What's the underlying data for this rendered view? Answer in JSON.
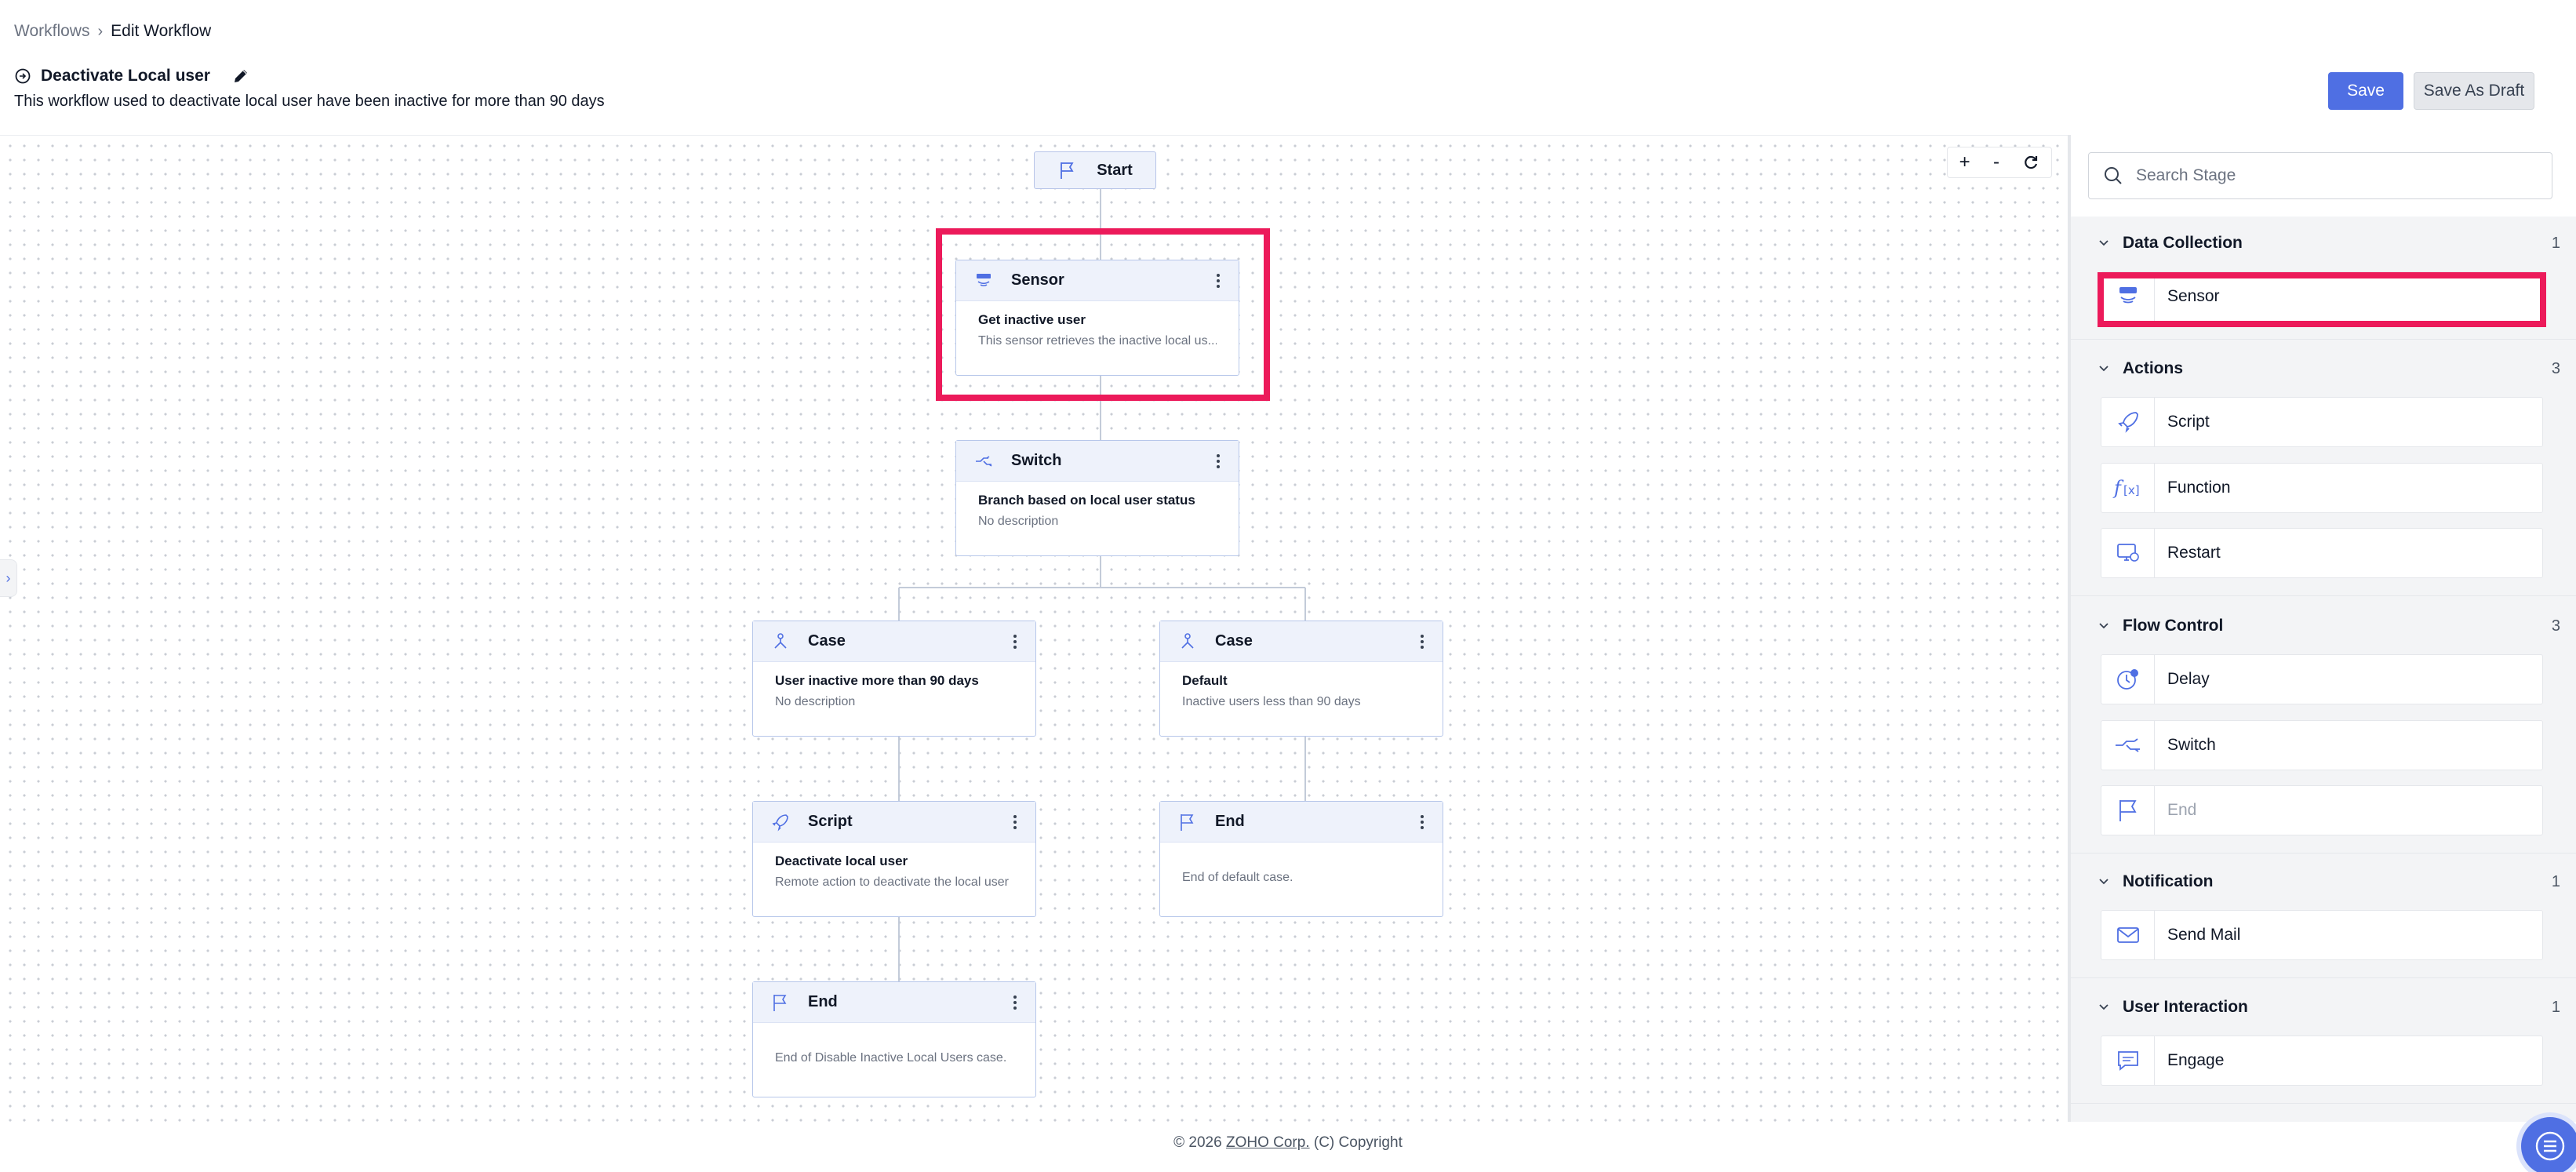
{
  "breadcrumb": {
    "parent": "Workflows",
    "current": "Edit Workflow"
  },
  "workflow": {
    "title": "Deactivate Local user",
    "description": "This workflow used to deactivate local user have been inactive for more than 90 days"
  },
  "actions": {
    "save": "Save",
    "save_draft": "Save As Draft"
  },
  "colors": {
    "accent": "#4f6fe3",
    "highlight": "#ec1a5a",
    "node_header": "#eef2fb",
    "node_border": "#b7c7ea"
  },
  "canvas": {
    "zoom_controls": {
      "zoom_in": "+",
      "zoom_out": "-",
      "reset_icon": "refresh-icon"
    },
    "start": {
      "label": "Start",
      "icon": "flag-icon"
    },
    "nodes": {
      "sensor": {
        "type": "Sensor",
        "icon": "sensor-icon",
        "name": "Get inactive user",
        "desc": "This sensor retrieves the inactive local us..."
      },
      "switch": {
        "type": "Switch",
        "icon": "switch-icon",
        "name": "Branch based on local user status",
        "desc": "No description"
      },
      "case1": {
        "type": "Case",
        "icon": "case-icon",
        "name": "User inactive more than 90 days",
        "desc": "No description"
      },
      "case2": {
        "type": "Case",
        "icon": "case-icon",
        "name": "Default",
        "desc": "Inactive users less than 90 days"
      },
      "script": {
        "type": "Script",
        "icon": "script-icon",
        "name": "Deactivate local user",
        "desc": "Remote action to deactivate the local user"
      },
      "end_default": {
        "type": "End",
        "icon": "flag-icon",
        "name": "",
        "desc": "End of default case."
      },
      "end_case1": {
        "type": "End",
        "icon": "flag-icon",
        "name": "",
        "desc": "End of Disable Inactive Local Users case."
      }
    }
  },
  "panel": {
    "search": {
      "placeholder": "Search Stage"
    },
    "groups": [
      {
        "title": "Data Collection",
        "count": "1",
        "items": [
          {
            "label": "Sensor",
            "icon": "sensor-icon"
          }
        ]
      },
      {
        "title": "Actions",
        "count": "3",
        "items": [
          {
            "label": "Script",
            "icon": "script-icon"
          },
          {
            "label": "Function",
            "icon": "function-icon"
          },
          {
            "label": "Restart",
            "icon": "restart-icon"
          }
        ]
      },
      {
        "title": "Flow Control",
        "count": "3",
        "items": [
          {
            "label": "Delay",
            "icon": "delay-icon"
          },
          {
            "label": "Switch",
            "icon": "switch-icon"
          },
          {
            "label": "End",
            "icon": "flag-icon",
            "disabled": true
          }
        ]
      },
      {
        "title": "Notification",
        "count": "1",
        "items": [
          {
            "label": "Send Mail",
            "icon": "mail-icon"
          }
        ]
      },
      {
        "title": "User Interaction",
        "count": "1",
        "items": [
          {
            "label": "Engage",
            "icon": "chat-icon"
          }
        ]
      }
    ]
  },
  "footer": {
    "year": "© 2026",
    "company": "ZOHO Corp.",
    "suffix": "(C) Copyright"
  }
}
